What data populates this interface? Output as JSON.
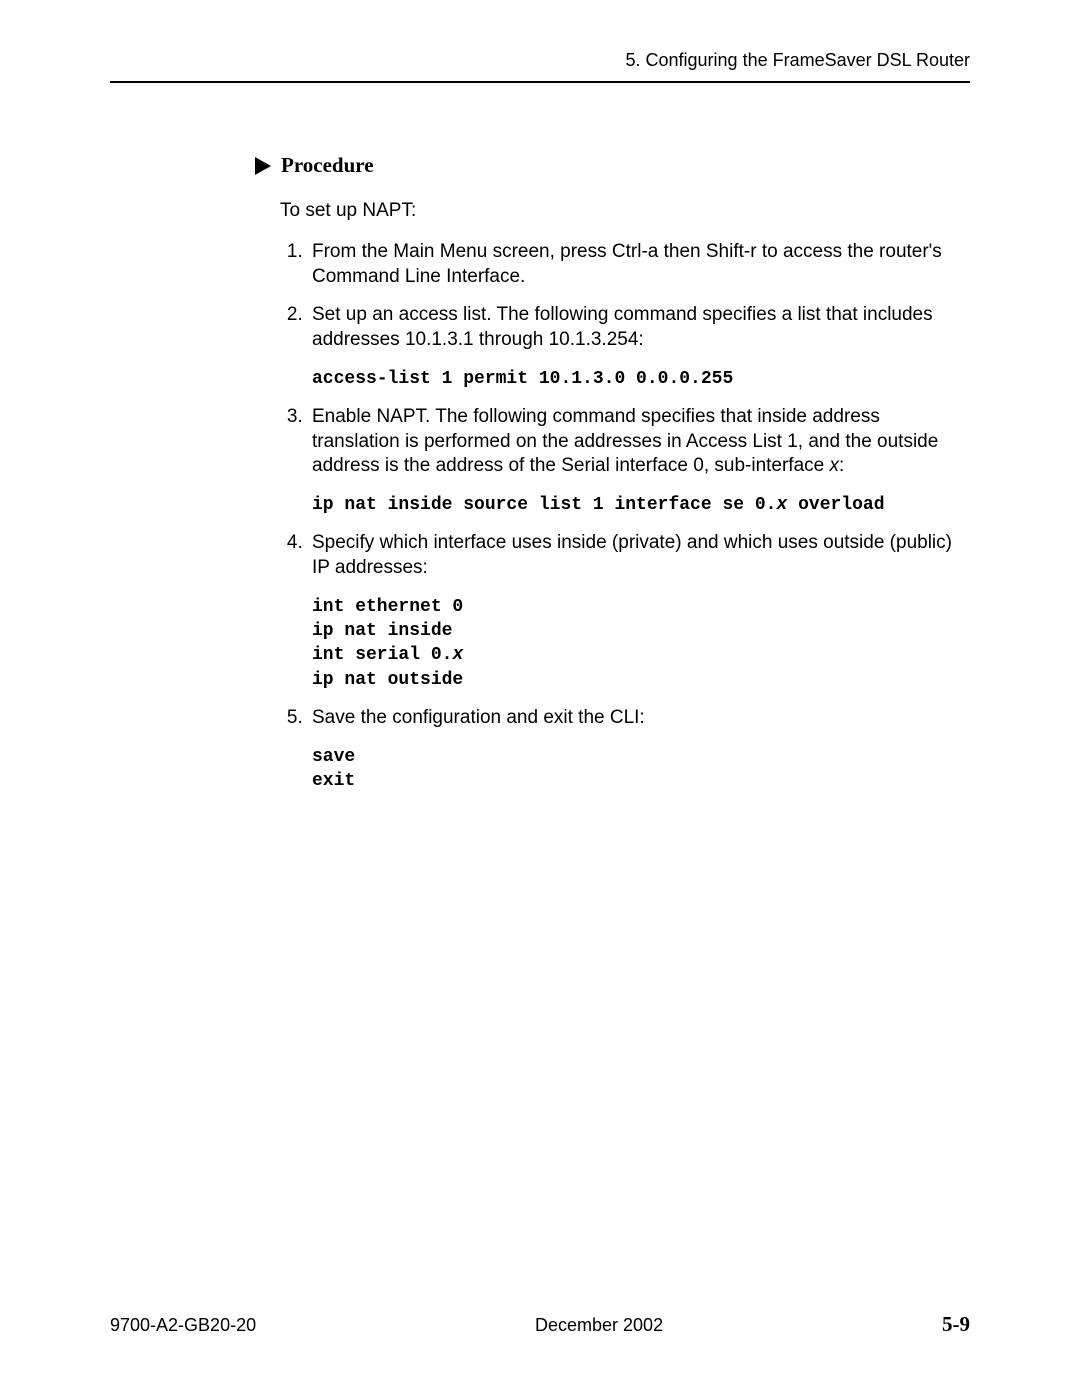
{
  "header": {
    "chapter": "5. Configuring the FrameSaver DSL Router"
  },
  "procedure": {
    "heading": "Procedure",
    "intro": "To set up NAPT:",
    "steps": {
      "s1": "From the Main Menu screen, press Ctrl-a then Shift-r to access the router's Command Line Interface.",
      "s2": "Set up an access list. The following command specifies a list that includes addresses 10.1.3.1 through 10.1.3.254:",
      "s2_cmd": "access-list 1 permit 10.1.3.0 0.0.0.255",
      "s3_a": "Enable NAPT. The following command specifies that inside address translation is performed on the addresses in Access List 1, and the outside address is the address of the Serial interface 0, sub-interface ",
      "s3_ital": "x",
      "s3_b": ":",
      "s3_cmd_a": "ip nat inside source list 1 interface se 0.",
      "s3_cmd_ital": "x",
      "s3_cmd_b": " overload",
      "s4": "Specify which interface uses inside (private) and which uses outside (public) IP addresses:",
      "s4_cmd_l1": "int ethernet 0",
      "s4_cmd_l2": "ip nat inside",
      "s4_cmd_l3a": "int serial 0.",
      "s4_cmd_l3_ital": "x",
      "s4_cmd_l4": "ip nat outside",
      "s5": "Save the configuration and exit the CLI:",
      "s5_cmd_l1": "save",
      "s5_cmd_l2": "exit"
    }
  },
  "footer": {
    "doc_id": "9700-A2-GB20-20",
    "date": "December 2002",
    "page": "5-9"
  }
}
